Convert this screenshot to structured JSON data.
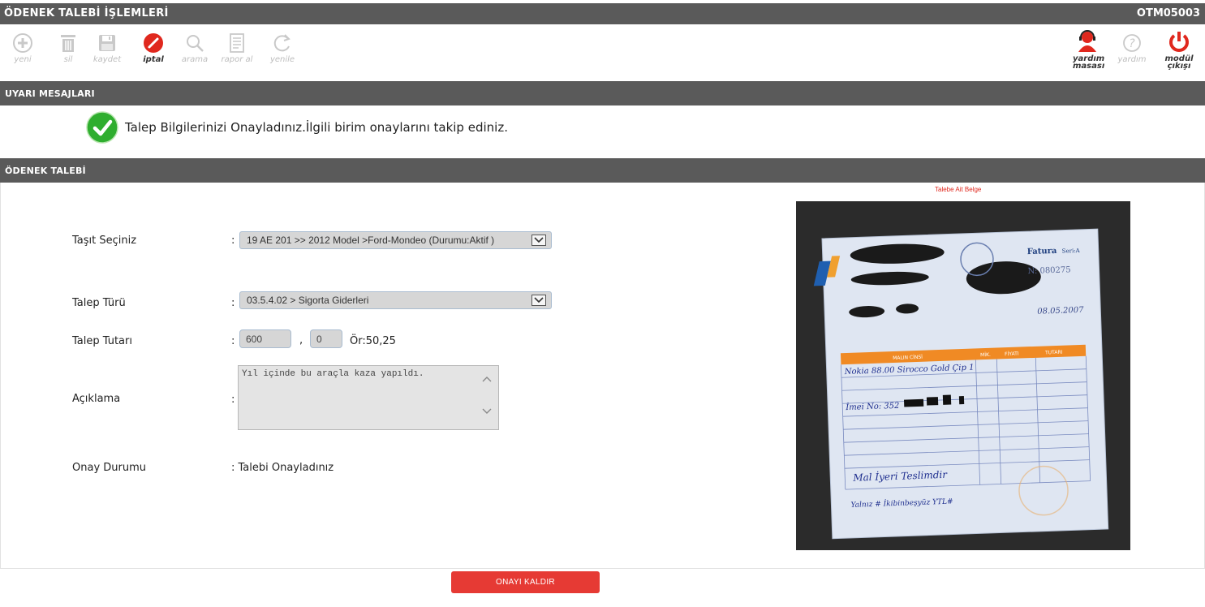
{
  "header": {
    "title": "ÖDENEK TALEBİ İŞLEMLERİ",
    "code": "OTM05003"
  },
  "toolbar": {
    "items": [
      {
        "label": "yeni",
        "icon": "plus-circle-icon"
      },
      {
        "label": "sil",
        "icon": "trash-icon"
      },
      {
        "label": "kaydet",
        "icon": "floppy-disk-icon"
      },
      {
        "label": "iptal",
        "icon": "cancel-icon"
      },
      {
        "label": "arama",
        "icon": "search-icon"
      },
      {
        "label": "rapor al",
        "icon": "report-icon"
      },
      {
        "label": "yenile",
        "icon": "refresh-icon"
      }
    ],
    "right_items": [
      {
        "label_line1": "yardım",
        "label_line2": "masası",
        "icon": "helpdesk-icon"
      },
      {
        "label": "yardım",
        "icon": "help-icon"
      },
      {
        "label_line1": "modül",
        "label_line2": "çıkışı",
        "icon": "power-icon"
      }
    ]
  },
  "warnings": {
    "title": "UYARI MESAJLARI",
    "message": "Talep Bilgilerinizi Onayladınız.İlgili birim onaylarını takip ediniz."
  },
  "form": {
    "title": "ÖDENEK TALEBİ",
    "vehicle": {
      "label": "Taşıt Seçiniz",
      "value": "19 AE 201 >> 2012 Model >Ford-Mondeo (Durumu:Aktif )"
    },
    "request_type": {
      "label": "Talep Türü",
      "value": "03.5.4.02 > Sigorta Giderleri"
    },
    "amount": {
      "label": "Talep Tutarı",
      "whole": "600",
      "separator": ",",
      "fraction": "0",
      "hint": "Ör:50,25"
    },
    "description": {
      "label": "Açıklama",
      "value": "Yıl içinde bu araçla kaza yapıldı."
    },
    "status": {
      "label": "Onay Durumu",
      "value": ": Talebi Onayladınız"
    },
    "colon": ":"
  },
  "document": {
    "caption": "Talebe Ait Belge",
    "invoice_title": "Fatura",
    "invoice_series": "Seri:A",
    "invoice_no": "N: 080275",
    "date": "08.05.2007",
    "col_headers": [
      "MALIN CİNSİ",
      "MİK.",
      "FİYATI",
      "TUTARI"
    ],
    "line1": "Nokia 88.00 Sirocco Gold Çip 1",
    "line2": "İmei No: 352",
    "note": "Mal İyeri Teslimdir",
    "total_words": "Yalnız # İkibinbeşyüz YTL#"
  },
  "actions": {
    "remove_approval": "ONAYI KALDIR"
  },
  "colors": {
    "bar": "#5a5a5a",
    "accent": "#e63a34",
    "ok": "#2fae2f"
  }
}
